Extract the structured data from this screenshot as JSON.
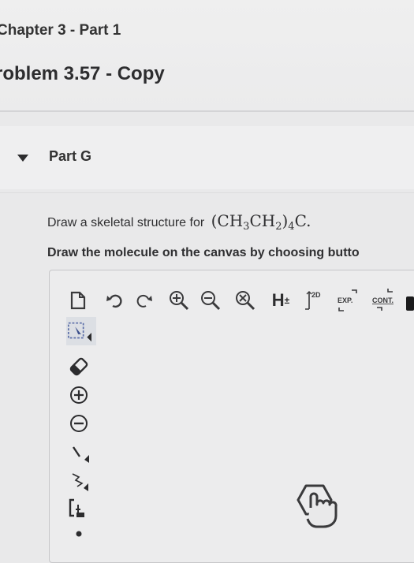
{
  "breadcrumb": "Chapter 3 - Part 1",
  "problem_title": "roblem 3.57 - Copy",
  "part": {
    "label": "Part G"
  },
  "question": {
    "prompt_text": "Draw a skeletal structure for ",
    "formula_open": "(CH",
    "sub_3": "3",
    "formula_mid": "CH",
    "sub_2": "2",
    "formula_close": ")",
    "sub_4": "4",
    "formula_end": "C.",
    "instruction": "Draw the molecule on the canvas by choosing butto"
  },
  "toolbar": {
    "explicit_h_label": "H",
    "explicit_h_sup": "±",
    "clean_2d_label": "2D",
    "expand_label": "EXP.",
    "contract_label": "CONT."
  },
  "colors": {
    "background": "#e9e9ea",
    "text": "#2d2d2f",
    "icon": "#3a3a3c"
  },
  "icons": [
    "new-document-icon",
    "undo-icon",
    "redo-icon",
    "zoom-in-icon",
    "zoom-out-icon",
    "reset-zoom-icon",
    "explicit-hydrogen-icon",
    "clean-2d-icon",
    "expand-icon",
    "contract-icon",
    "select-lasso-icon",
    "eraser-icon",
    "positive-charge-icon",
    "negative-charge-icon",
    "single-bond-icon",
    "chain-icon",
    "bracket-icon",
    "templates-icon"
  ]
}
